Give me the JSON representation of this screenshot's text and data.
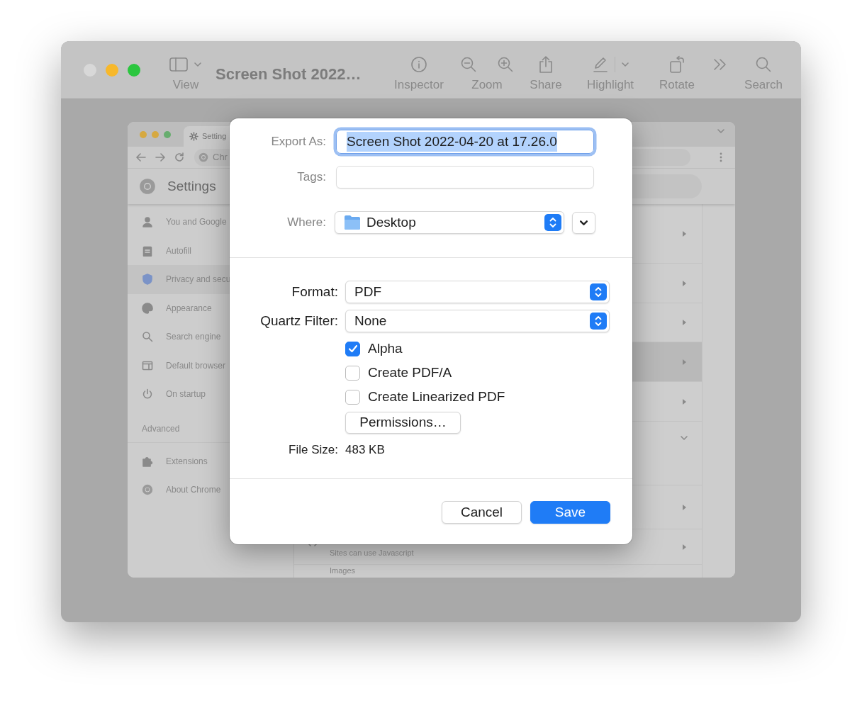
{
  "preview_window": {
    "traffic_lights": [
      {
        "color": "#d8d8d8"
      },
      {
        "color": "#f7b82b"
      },
      {
        "color": "#2bc63f"
      }
    ],
    "toolbar_left": [
      {
        "kind": "view",
        "label": "View"
      }
    ],
    "title": "Screen Shot 2022…",
    "toolbar": [
      {
        "kind": "inspector",
        "label": "Inspector"
      },
      {
        "kind": "zoom",
        "label": "Zoom"
      },
      {
        "kind": "share",
        "label": "Share"
      },
      {
        "kind": "highlight",
        "label": "Highlight"
      },
      {
        "kind": "rotate",
        "label": "Rotate"
      },
      {
        "kind": "more"
      },
      {
        "kind": "search",
        "label": "Search"
      }
    ]
  },
  "chrome_window": {
    "traffic_lights": [
      {
        "color": "#d6a941"
      },
      {
        "color": "#d6a941"
      },
      {
        "color": "#67ad6e"
      }
    ],
    "tab": "Setting",
    "address": "Chr",
    "header": "Settings",
    "sidebar": [
      {
        "label": "You and Google",
        "selected": false
      },
      {
        "label": "Autofill",
        "selected": false
      },
      {
        "label": "Privacy and secu",
        "selected": true
      },
      {
        "label": "Appearance",
        "selected": false
      },
      {
        "label": "Search engine",
        "selected": false
      },
      {
        "label": "Default browser",
        "selected": false
      },
      {
        "label": "On startup",
        "selected": false
      }
    ],
    "advanced": "Advanced",
    "sidebar_more": [
      {
        "label": "Extensions"
      },
      {
        "label": "About Chrome"
      }
    ],
    "rows": [
      {
        "kind": "arrow",
        "highlighted": false
      },
      {
        "kind": "arrow",
        "highlighted": false
      },
      {
        "kind": "arrow",
        "highlighted": false
      },
      {
        "kind": "arrow",
        "highlighted": true
      },
      {
        "kind": "arrow",
        "highlighted": false
      },
      {
        "kind": "expand",
        "highlighted": false
      },
      {
        "kind": "arrow",
        "highlighted": false
      },
      {
        "kind": "arrow",
        "highlighted": false,
        "subtitle": "Sites can use Javascript"
      },
      {
        "kind": "title",
        "highlighted": false,
        "title": "Images"
      }
    ]
  },
  "export_dialog": {
    "export_as": {
      "label": "Export As:",
      "value": "Screen Shot 2022-04-20 at 17.26.0",
      "focused": true
    },
    "tags": {
      "label": "Tags:"
    },
    "where": {
      "label": "Where:",
      "value": "Desktop"
    },
    "options": [
      {
        "label": "Format:",
        "value": "PDF"
      },
      {
        "label": "Quartz Filter:",
        "value": "None"
      }
    ],
    "checkboxes": [
      {
        "label": "Alpha",
        "checked": true
      },
      {
        "label": "Create PDF/A",
        "checked": false
      },
      {
        "label": "Create Linearized PDF",
        "checked": false
      }
    ],
    "permissions_button": "Permissions…",
    "file_size": {
      "label": "File Size:",
      "value": "483 KB"
    },
    "buttons": [
      {
        "label": "Cancel",
        "default": false
      },
      {
        "label": "Save",
        "default": true
      }
    ]
  }
}
